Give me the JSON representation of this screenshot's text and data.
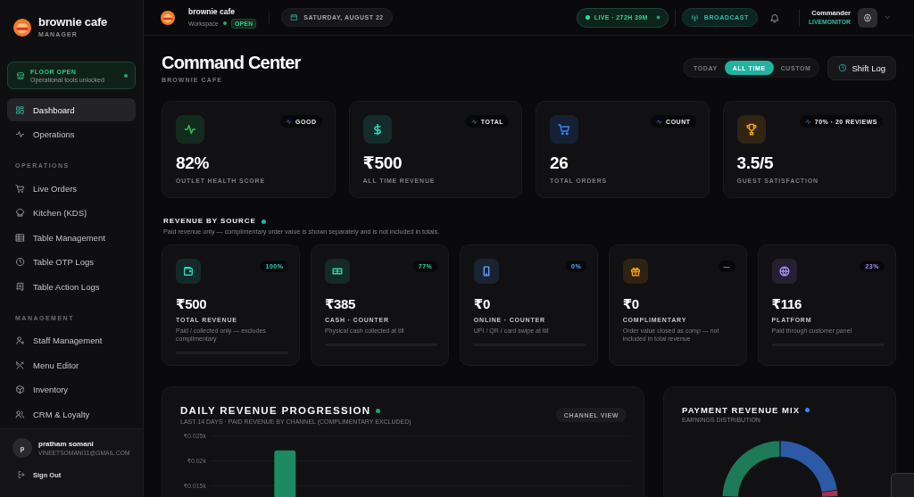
{
  "sidebar": {
    "brand": {
      "name": "brownie cafe",
      "role": "MANAGER"
    },
    "status_card": {
      "title": "FLOOR OPEN",
      "subtitle": "Operational tools unlocked"
    },
    "items": [
      {
        "label": "Dashboard",
        "selected": true
      },
      {
        "label": "Operations",
        "selected": false
      }
    ],
    "sections": [
      {
        "heading": "OPERATIONS",
        "items": [
          {
            "label": "Live Orders",
            "selected": false
          },
          {
            "label": "Kitchen (KDS)",
            "selected": false
          },
          {
            "label": "Table Management",
            "selected": false
          },
          {
            "label": "Table OTP Logs",
            "selected": false
          },
          {
            "label": "Table Action Logs",
            "selected": false
          }
        ]
      },
      {
        "heading": "MANAGEMENT",
        "items": [
          {
            "label": "Staff Management",
            "selected": false
          },
          {
            "label": "Menu Editor",
            "selected": false
          },
          {
            "label": "Inventory",
            "selected": false
          },
          {
            "label": "CRM & Loyalty",
            "selected": false
          }
        ]
      }
    ],
    "user": {
      "initial": "p",
      "name": "pratham somani",
      "email": "VINEETSOMANI11@GMAIL.COM"
    },
    "sign_out": "Sign Out"
  },
  "top_bar": {
    "workspace_name": "brownie cafe",
    "workspace_label": "Workspace",
    "status_badge": "OPEN",
    "date": "SATURDAY, AUGUST 22",
    "live": "LIVE · 272H 39M",
    "broadcast": "BROADCAST",
    "user_name": "Commander",
    "user_role": "LIVEMONITOR"
  },
  "header": {
    "title": "Command Center",
    "subtitle": "BROWNIE CAFE",
    "ranges": [
      {
        "label": "TODAY",
        "selected": false
      },
      {
        "label": "ALL TIME",
        "selected": true
      },
      {
        "label": "CUSTOM",
        "selected": false
      }
    ],
    "shift_log": "Shift Log"
  },
  "kpi_cards": [
    {
      "value": "82%",
      "label": "OUTLET HEALTH SCORE",
      "badge": "GOOD"
    },
    {
      "value": "₹500",
      "label": "ALL TIME REVENUE",
      "badge": "TOTAL"
    },
    {
      "value": "26",
      "label": "TOTAL ORDERS",
      "badge": "COUNT"
    },
    {
      "value": "3.5/5",
      "label": "GUEST SATISFACTION",
      "badge": "70% · 20 REVIEWS"
    }
  ],
  "revenue_by_source": {
    "title": "REVENUE BY SOURCE",
    "note": "Paid revenue only — complimentary order value is shown separately and is not included in totals.",
    "cards": [
      {
        "value": "₹500",
        "label": "TOTAL REVENUE",
        "description": "Paid / collected only — excludes complimentary",
        "badge": "100%",
        "progress_track": true
      },
      {
        "value": "₹385",
        "label": "CASH · COUNTER",
        "description": "Physical cash collected at till",
        "badge": "77%",
        "progress_track": true
      },
      {
        "value": "₹0",
        "label": "ONLINE · COUNTER",
        "description": "UPI / QR / card swipe at till",
        "badge": "0%",
        "progress_track": true
      },
      {
        "value": "₹0",
        "label": "COMPLIMENTARY",
        "description": "Order value closed as comp — not included in total revenue",
        "badge": "—",
        "progress_track": false
      },
      {
        "value": "₹116",
        "label": "PLATFORM",
        "description": "Paid through customer panel",
        "badge": "23%",
        "progress_track": true
      }
    ]
  },
  "daily_revenue": {
    "title": "DAILY REVENUE PROGRESSION",
    "subtitle": "LAST 14 DAYS · PAID REVENUE BY CHANNEL (COMPLIMENTARY EXCLUDED)",
    "button": "CHANNEL VIEW",
    "chart_data": {
      "type": "bar",
      "grid": true,
      "values": [
        null,
        null,
        0.022,
        null,
        null,
        null,
        null,
        null,
        null,
        null,
        null,
        null,
        null,
        null
      ],
      "ylim": [
        0.0125,
        0.025
      ],
      "yticks": [
        {
          "value": 0.025,
          "label": "₹0.025k"
        },
        {
          "value": 0.02,
          "label": "₹0.02k"
        },
        {
          "value": 0.015,
          "label": "₹0.015k"
        }
      ]
    }
  },
  "payment_mix": {
    "title": "PAYMENT REVENUE MIX",
    "subtitle": "EARNINGS DISTRIBUTION"
  }
}
